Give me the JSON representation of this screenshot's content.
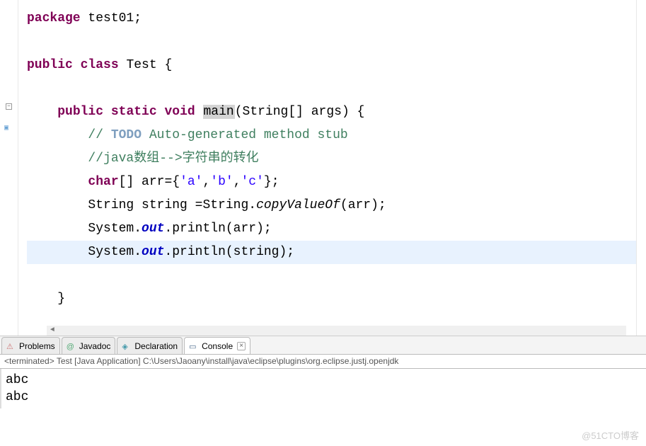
{
  "code": {
    "lines": [
      {
        "indent": 0,
        "tokens": [
          {
            "t": "kw-purple",
            "v": "package"
          },
          {
            "t": "txt",
            "v": " test01;"
          }
        ]
      },
      {
        "indent": 0,
        "tokens": []
      },
      {
        "indent": 0,
        "tokens": [
          {
            "t": "kw-purple",
            "v": "public"
          },
          {
            "t": "txt",
            "v": " "
          },
          {
            "t": "kw-purple",
            "v": "class"
          },
          {
            "t": "txt",
            "v": " Test {"
          }
        ]
      },
      {
        "indent": 0,
        "tokens": []
      },
      {
        "indent": 1,
        "tokens": [
          {
            "t": "kw-purple",
            "v": "public"
          },
          {
            "t": "txt",
            "v": " "
          },
          {
            "t": "kw-purple",
            "v": "static"
          },
          {
            "t": "txt",
            "v": " "
          },
          {
            "t": "kw-purple",
            "v": "void"
          },
          {
            "t": "txt",
            "v": " "
          },
          {
            "t": "txt occ-bg",
            "v": "main"
          },
          {
            "t": "txt",
            "v": "(String[] args) {"
          }
        ]
      },
      {
        "indent": 2,
        "tokens": [
          {
            "t": "comment",
            "v": "// "
          },
          {
            "t": "task",
            "v": "TODO"
          },
          {
            "t": "comment",
            "v": " Auto-generated method stub"
          }
        ]
      },
      {
        "indent": 2,
        "tokens": [
          {
            "t": "comment",
            "v": "//java数组-->字符串的转化"
          }
        ]
      },
      {
        "indent": 2,
        "tokens": [
          {
            "t": "kw-purple",
            "v": "char"
          },
          {
            "t": "txt",
            "v": "[] arr={"
          },
          {
            "t": "str",
            "v": "'a'"
          },
          {
            "t": "txt",
            "v": ","
          },
          {
            "t": "str",
            "v": "'b'"
          },
          {
            "t": "txt",
            "v": ","
          },
          {
            "t": "str",
            "v": "'c'"
          },
          {
            "t": "txt",
            "v": "};"
          }
        ]
      },
      {
        "indent": 2,
        "tokens": [
          {
            "t": "txt",
            "v": "String string =String."
          },
          {
            "t": "txt method-static",
            "v": "copyValueOf"
          },
          {
            "t": "txt",
            "v": "(arr);"
          }
        ]
      },
      {
        "indent": 2,
        "tokens": [
          {
            "t": "txt",
            "v": "System."
          },
          {
            "t": "field",
            "v": "out"
          },
          {
            "t": "txt",
            "v": ".println(arr);"
          }
        ]
      },
      {
        "indent": 2,
        "hl": true,
        "tokens": [
          {
            "t": "txt",
            "v": "System."
          },
          {
            "t": "field",
            "v": "out"
          },
          {
            "t": "txt",
            "v": ".println(string);"
          }
        ]
      },
      {
        "indent": 0,
        "tokens": []
      },
      {
        "indent": 1,
        "tokens": [
          {
            "t": "txt",
            "v": "}"
          }
        ]
      }
    ]
  },
  "tabs": {
    "items": [
      {
        "label": "Problems",
        "icon": "problems",
        "active": false
      },
      {
        "label": "Javadoc",
        "icon": "javadoc",
        "active": false
      },
      {
        "label": "Declaration",
        "icon": "declaration",
        "active": false
      },
      {
        "label": "Console",
        "icon": "console",
        "active": true,
        "closable": true
      }
    ]
  },
  "console": {
    "header": "<terminated> Test [Java Application] C:\\Users\\Jaoany\\install\\java\\eclipse\\plugins\\org.eclipse.justj.openjdk",
    "lines": [
      "abc",
      "abc"
    ]
  },
  "watermark": "@51CTO博客"
}
